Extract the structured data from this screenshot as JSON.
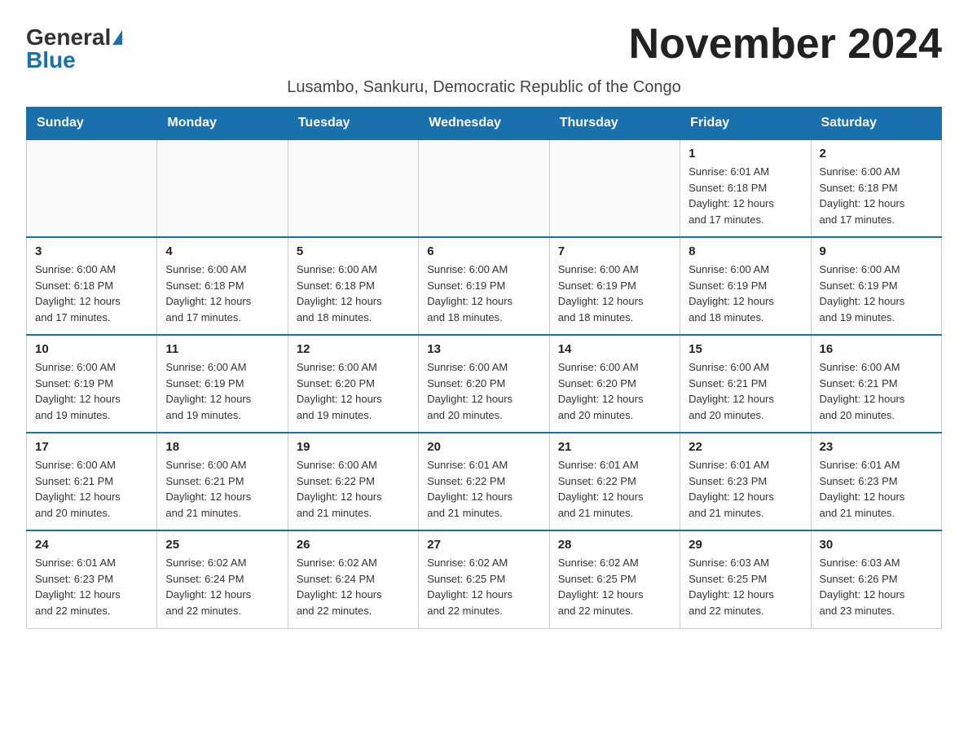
{
  "logo": {
    "general": "General",
    "blue": "Blue"
  },
  "title": "November 2024",
  "location": "Lusambo, Sankuru, Democratic Republic of the Congo",
  "days_of_week": [
    "Sunday",
    "Monday",
    "Tuesday",
    "Wednesday",
    "Thursday",
    "Friday",
    "Saturday"
  ],
  "weeks": [
    [
      {
        "day": "",
        "info": ""
      },
      {
        "day": "",
        "info": ""
      },
      {
        "day": "",
        "info": ""
      },
      {
        "day": "",
        "info": ""
      },
      {
        "day": "",
        "info": ""
      },
      {
        "day": "1",
        "info": "Sunrise: 6:01 AM\nSunset: 6:18 PM\nDaylight: 12 hours\nand 17 minutes."
      },
      {
        "day": "2",
        "info": "Sunrise: 6:00 AM\nSunset: 6:18 PM\nDaylight: 12 hours\nand 17 minutes."
      }
    ],
    [
      {
        "day": "3",
        "info": "Sunrise: 6:00 AM\nSunset: 6:18 PM\nDaylight: 12 hours\nand 17 minutes."
      },
      {
        "day": "4",
        "info": "Sunrise: 6:00 AM\nSunset: 6:18 PM\nDaylight: 12 hours\nand 17 minutes."
      },
      {
        "day": "5",
        "info": "Sunrise: 6:00 AM\nSunset: 6:18 PM\nDaylight: 12 hours\nand 18 minutes."
      },
      {
        "day": "6",
        "info": "Sunrise: 6:00 AM\nSunset: 6:19 PM\nDaylight: 12 hours\nand 18 minutes."
      },
      {
        "day": "7",
        "info": "Sunrise: 6:00 AM\nSunset: 6:19 PM\nDaylight: 12 hours\nand 18 minutes."
      },
      {
        "day": "8",
        "info": "Sunrise: 6:00 AM\nSunset: 6:19 PM\nDaylight: 12 hours\nand 18 minutes."
      },
      {
        "day": "9",
        "info": "Sunrise: 6:00 AM\nSunset: 6:19 PM\nDaylight: 12 hours\nand 19 minutes."
      }
    ],
    [
      {
        "day": "10",
        "info": "Sunrise: 6:00 AM\nSunset: 6:19 PM\nDaylight: 12 hours\nand 19 minutes."
      },
      {
        "day": "11",
        "info": "Sunrise: 6:00 AM\nSunset: 6:19 PM\nDaylight: 12 hours\nand 19 minutes."
      },
      {
        "day": "12",
        "info": "Sunrise: 6:00 AM\nSunset: 6:20 PM\nDaylight: 12 hours\nand 19 minutes."
      },
      {
        "day": "13",
        "info": "Sunrise: 6:00 AM\nSunset: 6:20 PM\nDaylight: 12 hours\nand 20 minutes."
      },
      {
        "day": "14",
        "info": "Sunrise: 6:00 AM\nSunset: 6:20 PM\nDaylight: 12 hours\nand 20 minutes."
      },
      {
        "day": "15",
        "info": "Sunrise: 6:00 AM\nSunset: 6:21 PM\nDaylight: 12 hours\nand 20 minutes."
      },
      {
        "day": "16",
        "info": "Sunrise: 6:00 AM\nSunset: 6:21 PM\nDaylight: 12 hours\nand 20 minutes."
      }
    ],
    [
      {
        "day": "17",
        "info": "Sunrise: 6:00 AM\nSunset: 6:21 PM\nDaylight: 12 hours\nand 20 minutes."
      },
      {
        "day": "18",
        "info": "Sunrise: 6:00 AM\nSunset: 6:21 PM\nDaylight: 12 hours\nand 21 minutes."
      },
      {
        "day": "19",
        "info": "Sunrise: 6:00 AM\nSunset: 6:22 PM\nDaylight: 12 hours\nand 21 minutes."
      },
      {
        "day": "20",
        "info": "Sunrise: 6:01 AM\nSunset: 6:22 PM\nDaylight: 12 hours\nand 21 minutes."
      },
      {
        "day": "21",
        "info": "Sunrise: 6:01 AM\nSunset: 6:22 PM\nDaylight: 12 hours\nand 21 minutes."
      },
      {
        "day": "22",
        "info": "Sunrise: 6:01 AM\nSunset: 6:23 PM\nDaylight: 12 hours\nand 21 minutes."
      },
      {
        "day": "23",
        "info": "Sunrise: 6:01 AM\nSunset: 6:23 PM\nDaylight: 12 hours\nand 21 minutes."
      }
    ],
    [
      {
        "day": "24",
        "info": "Sunrise: 6:01 AM\nSunset: 6:23 PM\nDaylight: 12 hours\nand 22 minutes."
      },
      {
        "day": "25",
        "info": "Sunrise: 6:02 AM\nSunset: 6:24 PM\nDaylight: 12 hours\nand 22 minutes."
      },
      {
        "day": "26",
        "info": "Sunrise: 6:02 AM\nSunset: 6:24 PM\nDaylight: 12 hours\nand 22 minutes."
      },
      {
        "day": "27",
        "info": "Sunrise: 6:02 AM\nSunset: 6:25 PM\nDaylight: 12 hours\nand 22 minutes."
      },
      {
        "day": "28",
        "info": "Sunrise: 6:02 AM\nSunset: 6:25 PM\nDaylight: 12 hours\nand 22 minutes."
      },
      {
        "day": "29",
        "info": "Sunrise: 6:03 AM\nSunset: 6:25 PM\nDaylight: 12 hours\nand 22 minutes."
      },
      {
        "day": "30",
        "info": "Sunrise: 6:03 AM\nSunset: 6:26 PM\nDaylight: 12 hours\nand 23 minutes."
      }
    ]
  ]
}
